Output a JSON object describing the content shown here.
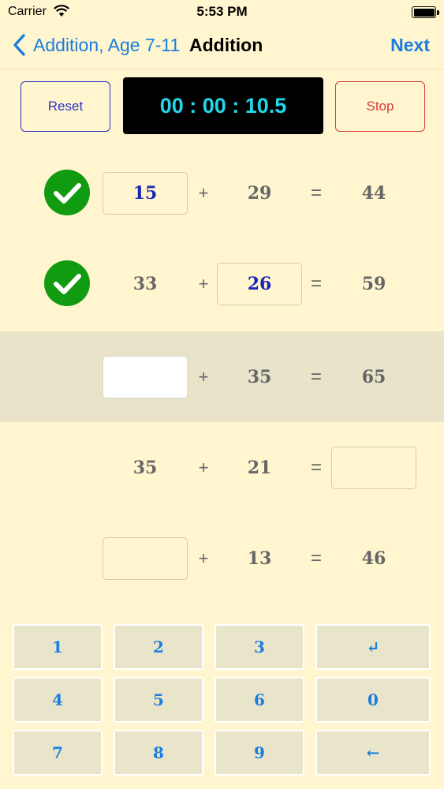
{
  "status_bar": {
    "carrier": "Carrier",
    "time": "5:53 PM"
  },
  "nav": {
    "back_label": "Addition, Age 7-11",
    "title": "Addition",
    "next_label": "Next"
  },
  "controls": {
    "reset_label": "Reset",
    "stop_label": "Stop",
    "timer": "00 : 00 : 10.5"
  },
  "problems": [
    {
      "a": "15",
      "op": "+",
      "b": "29",
      "eq": "=",
      "c": "44"
    },
    {
      "a": "33",
      "op": "+",
      "b": "26",
      "eq": "=",
      "c": "59"
    },
    {
      "a": "",
      "op": "+",
      "b": "35",
      "eq": "=",
      "c": "65"
    },
    {
      "a": "35",
      "op": "+",
      "b": "21",
      "eq": "=",
      "c": ""
    },
    {
      "a": "",
      "op": "+",
      "b": "13",
      "eq": "=",
      "c": "46"
    }
  ],
  "keypad": [
    "1",
    "2",
    "3",
    "↵",
    "4",
    "5",
    "6",
    "0",
    "7",
    "8",
    "9",
    "←"
  ],
  "colors": {
    "accent": "#1a7de0",
    "timer_text": "#1fd8ea",
    "check": "#119b11",
    "reset": "#2b33c9",
    "stop": "#d43c3c"
  }
}
